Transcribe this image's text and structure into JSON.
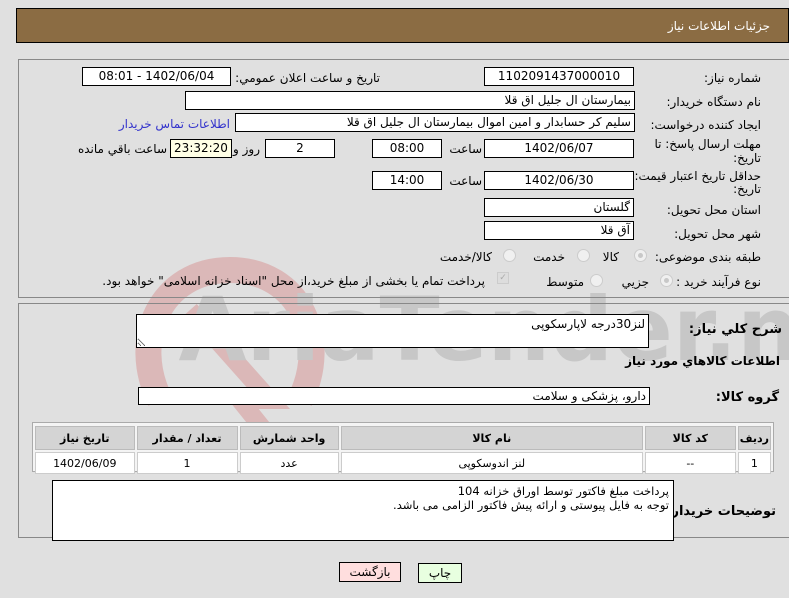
{
  "header": {
    "title": "جزئيات اطلاعات نياز"
  },
  "form": {
    "need_number": {
      "label": "شماره نياز:",
      "value": "1102091437000010"
    },
    "announce_datetime": {
      "label": "تاريخ و ساعت اعلان عمومي:",
      "value": "1402/06/04 - 08:01"
    },
    "buyer_org": {
      "label": "نام دستگاه خريدار:",
      "value": "بيمارستان ال جليل اق قلا"
    },
    "requester": {
      "label": "ايجاد كننده درخواست:",
      "value": "سليم كر حسابدار و امين اموال بيمارستان ال جليل اق قلا",
      "contact_link": "اطلاعات تماس خريدار"
    },
    "reply_deadline": {
      "label_line1": "مهلت ارسال پاسخ: تا",
      "label_line2": "تاريخ:",
      "date": "1402/06/07",
      "time_label": "ساعت",
      "time": "08:00",
      "days": "2",
      "days_label": "روز و",
      "remaining": "23:32:20",
      "remaining_label": "ساعت باقي مانده"
    },
    "price_validity": {
      "label_line1": "حداقل تاريخ اعتبار قيمت: تا",
      "label_line2": "تاريخ:",
      "date": "1402/06/30",
      "time_label": "ساعت",
      "time": "14:00"
    },
    "province": {
      "label": "استان محل تحويل:",
      "value": "گلستان"
    },
    "city": {
      "label": "شهر محل تحويل:",
      "value": "آق قلا"
    },
    "category": {
      "label": "طبقه بندی موضوعی:",
      "options": [
        "كالا",
        "خدمت",
        "كالا/خدمت"
      ],
      "selected": "كالا"
    },
    "purchase_type": {
      "label": "نوع فرآيند خريد :",
      "options": [
        "جزيي",
        "متوسط"
      ],
      "selected": "جزيي",
      "treasury_checkbox_label": "پرداخت تمام يا بخشی از مبلغ خريد،از محل \"اسناد خزانه اسلامی\" خواهد بود.",
      "treasury_checked": true
    }
  },
  "details": {
    "general_desc": {
      "label": "شرح كلي نياز:",
      "value": "لنز30درجه لاپارسکوپی"
    },
    "items_section_title": "اطلاعات كالاهاي مورد نياز",
    "goods_group": {
      "label": "گروه كالا:",
      "value": "دارو، پزشكی و سلامت"
    },
    "table": {
      "headers": [
        "رديف",
        "كد كالا",
        "نام كالا",
        "واحد شمارش",
        "تعداد / مقدار",
        "تاريخ نياز"
      ],
      "rows": [
        [
          "1",
          "--",
          "لنز اندوسکوپی",
          "عدد",
          "1",
          "1402/06/09"
        ]
      ]
    },
    "buyer_notes": {
      "label": "توضيحات خريدار:",
      "line1": "پرداخت مبلغ فاکتور توسط اوراق خزانه 104",
      "line2": "توجه به فایل پیوستی و ارائه پیش فاکتور الزامی می باشد."
    }
  },
  "buttons": {
    "print": "چاپ",
    "back": "بازگشت"
  },
  "watermark": {
    "text": "AriaTender.net"
  },
  "colors": {
    "header_bg": "#8b6c43",
    "print_bg": "#e8ffe0",
    "back_bg": "#ffdede",
    "link": "#3333cc"
  }
}
